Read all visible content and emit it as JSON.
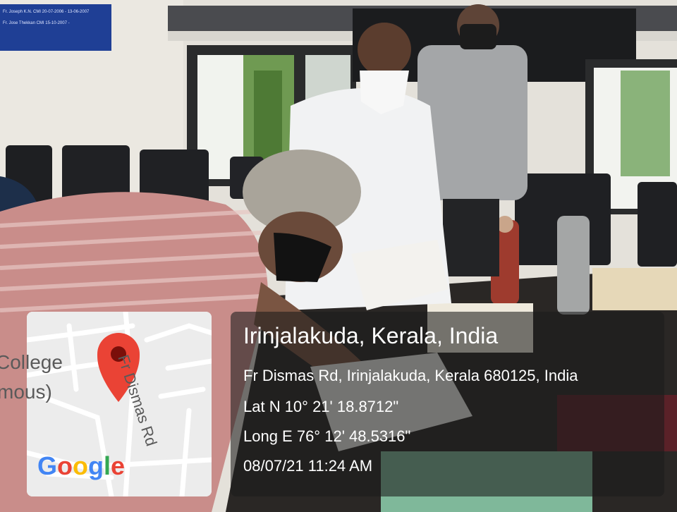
{
  "geotag": {
    "place": "Irinjalakuda, Kerala, India",
    "address": "Fr Dismas Rd, Irinjalakuda, Kerala 680125, India",
    "latitude": "Lat N 10° 21' 18.8712\"",
    "longitude": "Long E 76° 12' 48.5316\"",
    "datetime": "08/07/21 11:24 AM"
  },
  "map": {
    "label_college": "College",
    "label_partial": "mous)",
    "road_label": "Fr Dismas Rd",
    "logo_letters": [
      "G",
      "o",
      "o",
      "g",
      "l",
      "e"
    ],
    "logo_colors": [
      "#4285F4",
      "#EA4335",
      "#FBBC05",
      "#4285F4",
      "#34A853",
      "#EA4335"
    ],
    "pin_color": "#EA4335",
    "marker_icon": "map-pin-icon"
  },
  "photo": {
    "plaque_text": [
      "Fr. Joseph K.N. CMI   20-07-2006 - 13-06-2007",
      "Fr. Jose Thekkan CMI   15-10-2007 -"
    ]
  }
}
